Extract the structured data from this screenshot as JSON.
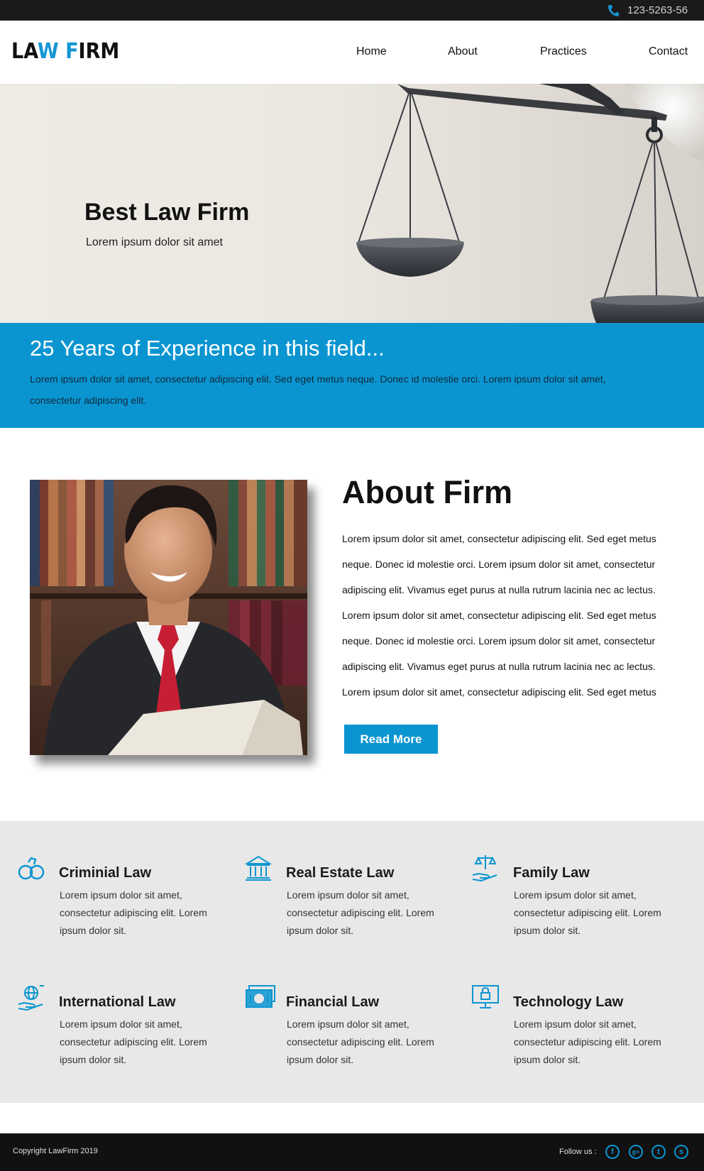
{
  "topbar": {
    "phone": "123-5263-56",
    "phone_icon": "phone-icon"
  },
  "header": {
    "logo_part1": "LA",
    "logo_part2": "W",
    "logo_part3": " ",
    "logo_part4": "F",
    "logo_part5": "IRM",
    "nav": [
      "Home",
      "About",
      "Practices",
      "Contact"
    ]
  },
  "hero": {
    "title": "Best Law Firm",
    "subtitle": "Lorem ipsum dolor sit amet"
  },
  "band": {
    "title": "25 Years of Experience in this field...",
    "text": "Lorem ipsum dolor sit amet, consectetur adipiscing elit. Sed eget metus neque. Donec id molestie orci. Lorem ipsum dolor sit amet, consectetur adipiscing elit."
  },
  "about": {
    "title": "About Firm",
    "text": "Lorem ipsum dolor sit amet, consectetur adipiscing elit. Sed eget metus neque. Donec id molestie orci. Lorem ipsum dolor sit amet, consectetur adipiscing elit. Vivamus eget purus at nulla rutrum lacinia nec ac lectus. Lorem ipsum dolor sit amet, consectetur adipiscing elit. Sed eget metus neque. Donec id molestie orci. Lorem ipsum dolor sit amet, consectetur adipiscing elit. Vivamus eget purus at nulla rutrum lacinia nec ac lectus. Lorem ipsum dolor sit amet, consectetur adipiscing elit. Sed eget metus",
    "button": "Read More"
  },
  "practices": [
    {
      "title": "Criminial Law",
      "icon": "handcuffs-icon",
      "text": "Lorem ipsum dolor sit amet, consectetur adipiscing elit. Lorem ipsum dolor sit."
    },
    {
      "title": "Real Estate Law",
      "icon": "courthouse-icon",
      "text": "Lorem ipsum dolor sit amet, consectetur adipiscing elit. Lorem ipsum dolor sit."
    },
    {
      "title": "Family Law",
      "icon": "scales-hand-icon",
      "text": "Lorem ipsum dolor sit amet, consectetur adipiscing elit. Lorem ipsum dolor sit."
    },
    {
      "title": "International Law",
      "icon": "globe-hand-icon",
      "text": "Lorem ipsum dolor sit amet, consectetur adipiscing elit. Lorem ipsum dolor sit."
    },
    {
      "title": "Financial Law",
      "icon": "money-icon",
      "text": "Lorem ipsum dolor sit amet, consectetur adipiscing elit. Lorem ipsum dolor sit."
    },
    {
      "title": "Technology Law",
      "icon": "monitor-lock-icon",
      "text": "Lorem ipsum dolor sit amet, consectetur adipiscing elit. Lorem ipsum dolor sit."
    }
  ],
  "footer": {
    "copyright": "Copyright LawFirm 2019",
    "follow": "Follow us :",
    "social": [
      "f",
      "g+",
      "t",
      "s"
    ],
    "social_icons": [
      "facebook-icon",
      "google-plus-icon",
      "twitter-icon",
      "skype-icon"
    ]
  },
  "colors": {
    "accent": "#0a95d1",
    "dark": "#111111",
    "topbar": "#1b1a1b",
    "practices_bg": "#e8e8e8"
  }
}
